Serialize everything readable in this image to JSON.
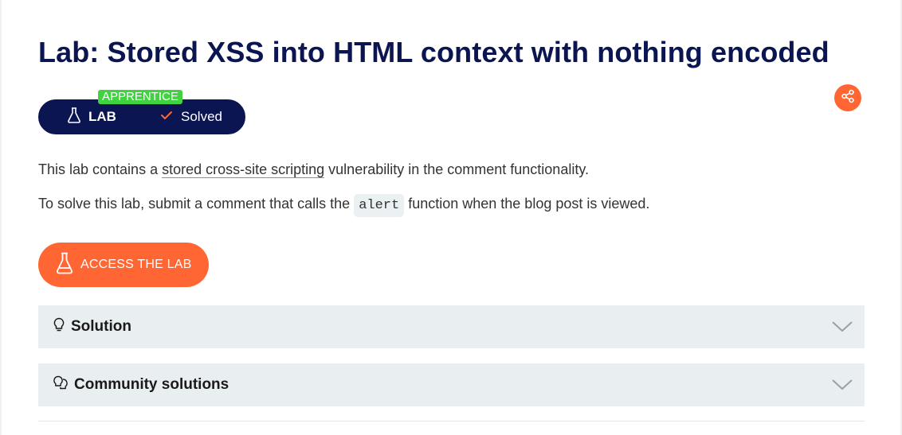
{
  "page": {
    "title": "Lab: Stored XSS into HTML context with nothing encoded"
  },
  "badge": {
    "level": "APPRENTICE",
    "lab_label": "LAB",
    "status": "Solved"
  },
  "description": {
    "line1_before": "This lab contains a ",
    "line1_link": "stored cross-site scripting",
    "line1_after": " vulnerability in the comment functionality.",
    "line2_before": "To solve this lab, submit a comment that calls the ",
    "line2_code": "alert",
    "line2_after": " function when the blog post is viewed."
  },
  "actions": {
    "access_lab": "ACCESS THE LAB"
  },
  "accordions": [
    {
      "title": "Solution",
      "icon": "lightbulb-icon"
    },
    {
      "title": "Community solutions",
      "icon": "lightbulbs-icon"
    }
  ],
  "colors": {
    "title": "#0a1551",
    "accent": "#ff6633",
    "level": "#3fd33f",
    "panel": "#e9eef1"
  }
}
